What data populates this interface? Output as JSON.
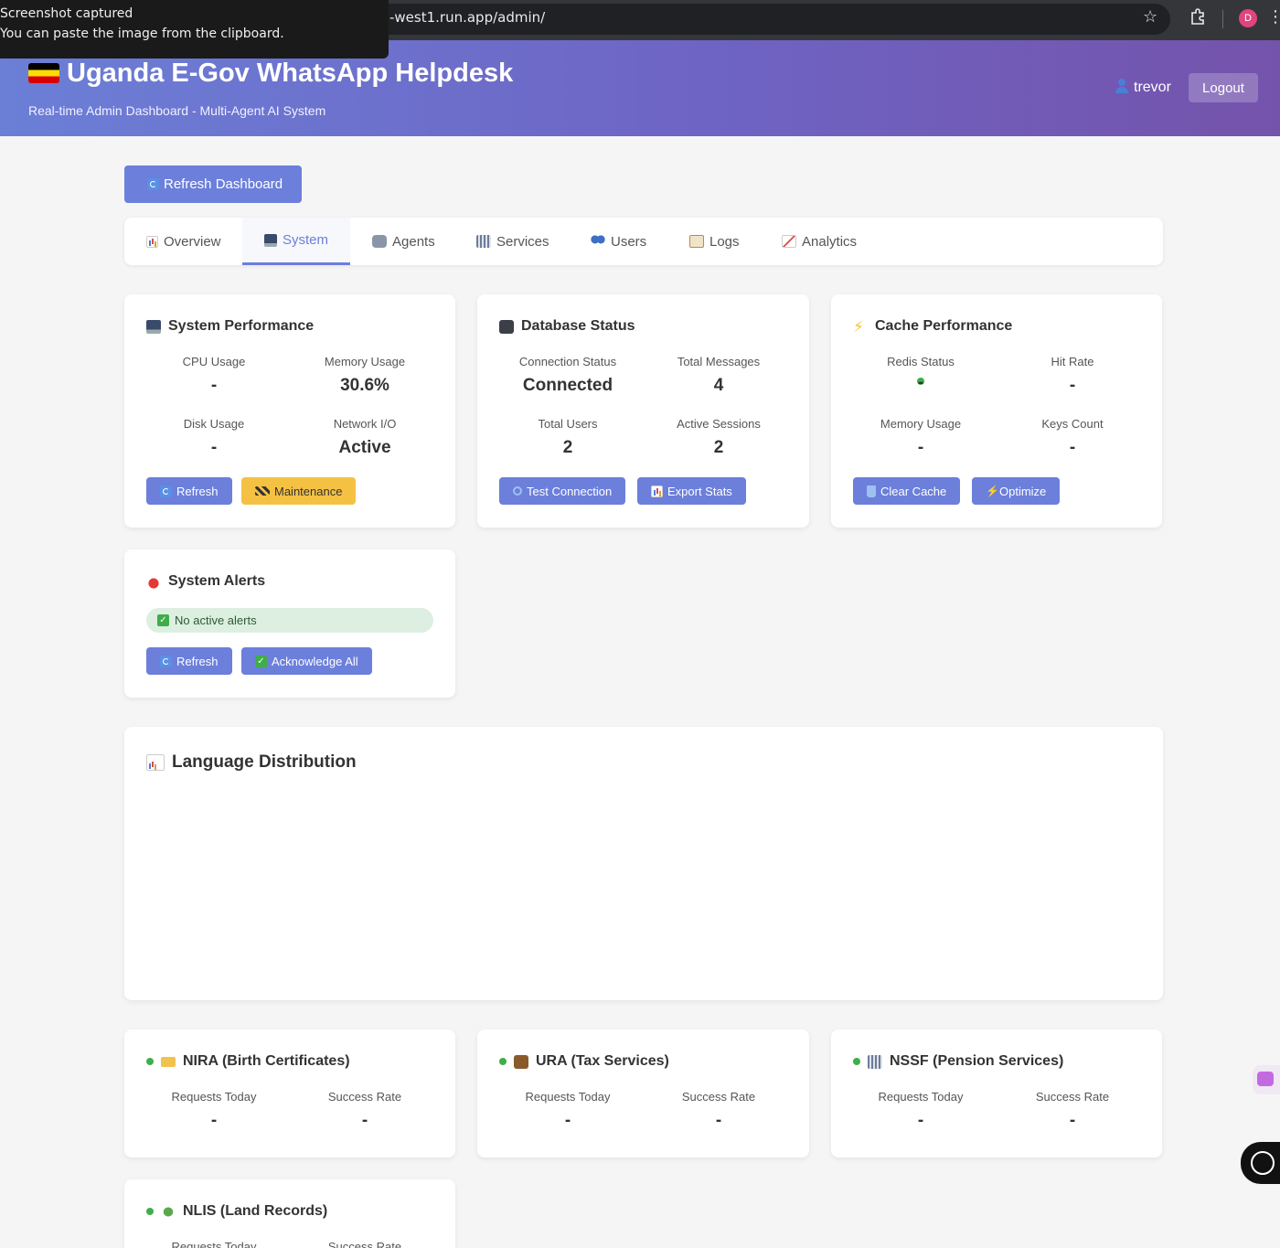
{
  "browser": {
    "url": "-west1.run.app/admin/",
    "profile_initial": "D"
  },
  "toast": {
    "line1": "Screenshot captured",
    "line2": "You can paste the image from the clipboard."
  },
  "header": {
    "title": "Uganda E-Gov WhatsApp Helpdesk",
    "subtitle": "Real-time Admin Dashboard - Multi-Agent AI System",
    "username": "trevor",
    "logout_label": "Logout"
  },
  "toolbar": {
    "refresh_label": "Refresh Dashboard"
  },
  "tabs": [
    {
      "label": "Overview",
      "icon": "chart-icon"
    },
    {
      "label": "System",
      "icon": "monitor-icon",
      "active": true
    },
    {
      "label": "Agents",
      "icon": "robot-icon"
    },
    {
      "label": "Services",
      "icon": "bank-icon"
    },
    {
      "label": "Users",
      "icon": "users-icon"
    },
    {
      "label": "Logs",
      "icon": "clipboard-icon"
    },
    {
      "label": "Analytics",
      "icon": "trend-icon"
    }
  ],
  "system_performance": {
    "title": "System Performance",
    "cpu_label": "CPU Usage",
    "cpu_value": "-",
    "memory_label": "Memory Usage",
    "memory_value": "30.6%",
    "disk_label": "Disk Usage",
    "disk_value": "-",
    "network_label": "Network I/O",
    "network_value": "Active",
    "refresh_label": "Refresh",
    "maintenance_label": "Maintenance"
  },
  "database_status": {
    "title": "Database Status",
    "connection_label": "Connection Status",
    "connection_value": "Connected",
    "messages_label": "Total Messages",
    "messages_value": "4",
    "users_label": "Total Users",
    "users_value": "2",
    "sessions_label": "Active Sessions",
    "sessions_value": "2",
    "test_label": "Test Connection",
    "export_label": "Export Stats"
  },
  "cache_performance": {
    "title": "Cache Performance",
    "redis_label": "Redis Status",
    "redis_value": "-",
    "hit_label": "Hit Rate",
    "hit_value": "-",
    "memory_label": "Memory Usage",
    "memory_value": "-",
    "keys_label": "Keys Count",
    "keys_value": "-",
    "clear_label": "Clear Cache",
    "optimize_label": "Optimize"
  },
  "system_alerts": {
    "title": "System Alerts",
    "status_text": "No active alerts",
    "refresh_label": "Refresh",
    "ack_label": "Acknowledge All"
  },
  "language_distribution": {
    "title": "Language Distribution"
  },
  "services": [
    {
      "name": "NIRA (Birth Certificates)",
      "icon": "ticket-icon",
      "requests_label": "Requests Today",
      "requests_value": "-",
      "success_label": "Success Rate",
      "success_value": "-"
    },
    {
      "name": "URA (Tax Services)",
      "icon": "briefcase-icon",
      "requests_label": "Requests Today",
      "requests_value": "-",
      "success_label": "Success Rate",
      "success_value": "-"
    },
    {
      "name": "NSSF (Pension Services)",
      "icon": "bank-icon",
      "requests_label": "Requests Today",
      "requests_value": "-",
      "success_label": "Success Rate",
      "success_value": "-"
    },
    {
      "name": "NLIS (Land Records)",
      "icon": "leaf-icon",
      "requests_label": "Requests Today",
      "requests_value": "-",
      "success_label": "Success Rate",
      "success_value": "-"
    }
  ],
  "colors": {
    "accent": "#6b7fdb",
    "warning": "#f5c143",
    "success": "#3fae4a",
    "header_start": "#6b7fd6",
    "header_end": "#7453ab"
  }
}
